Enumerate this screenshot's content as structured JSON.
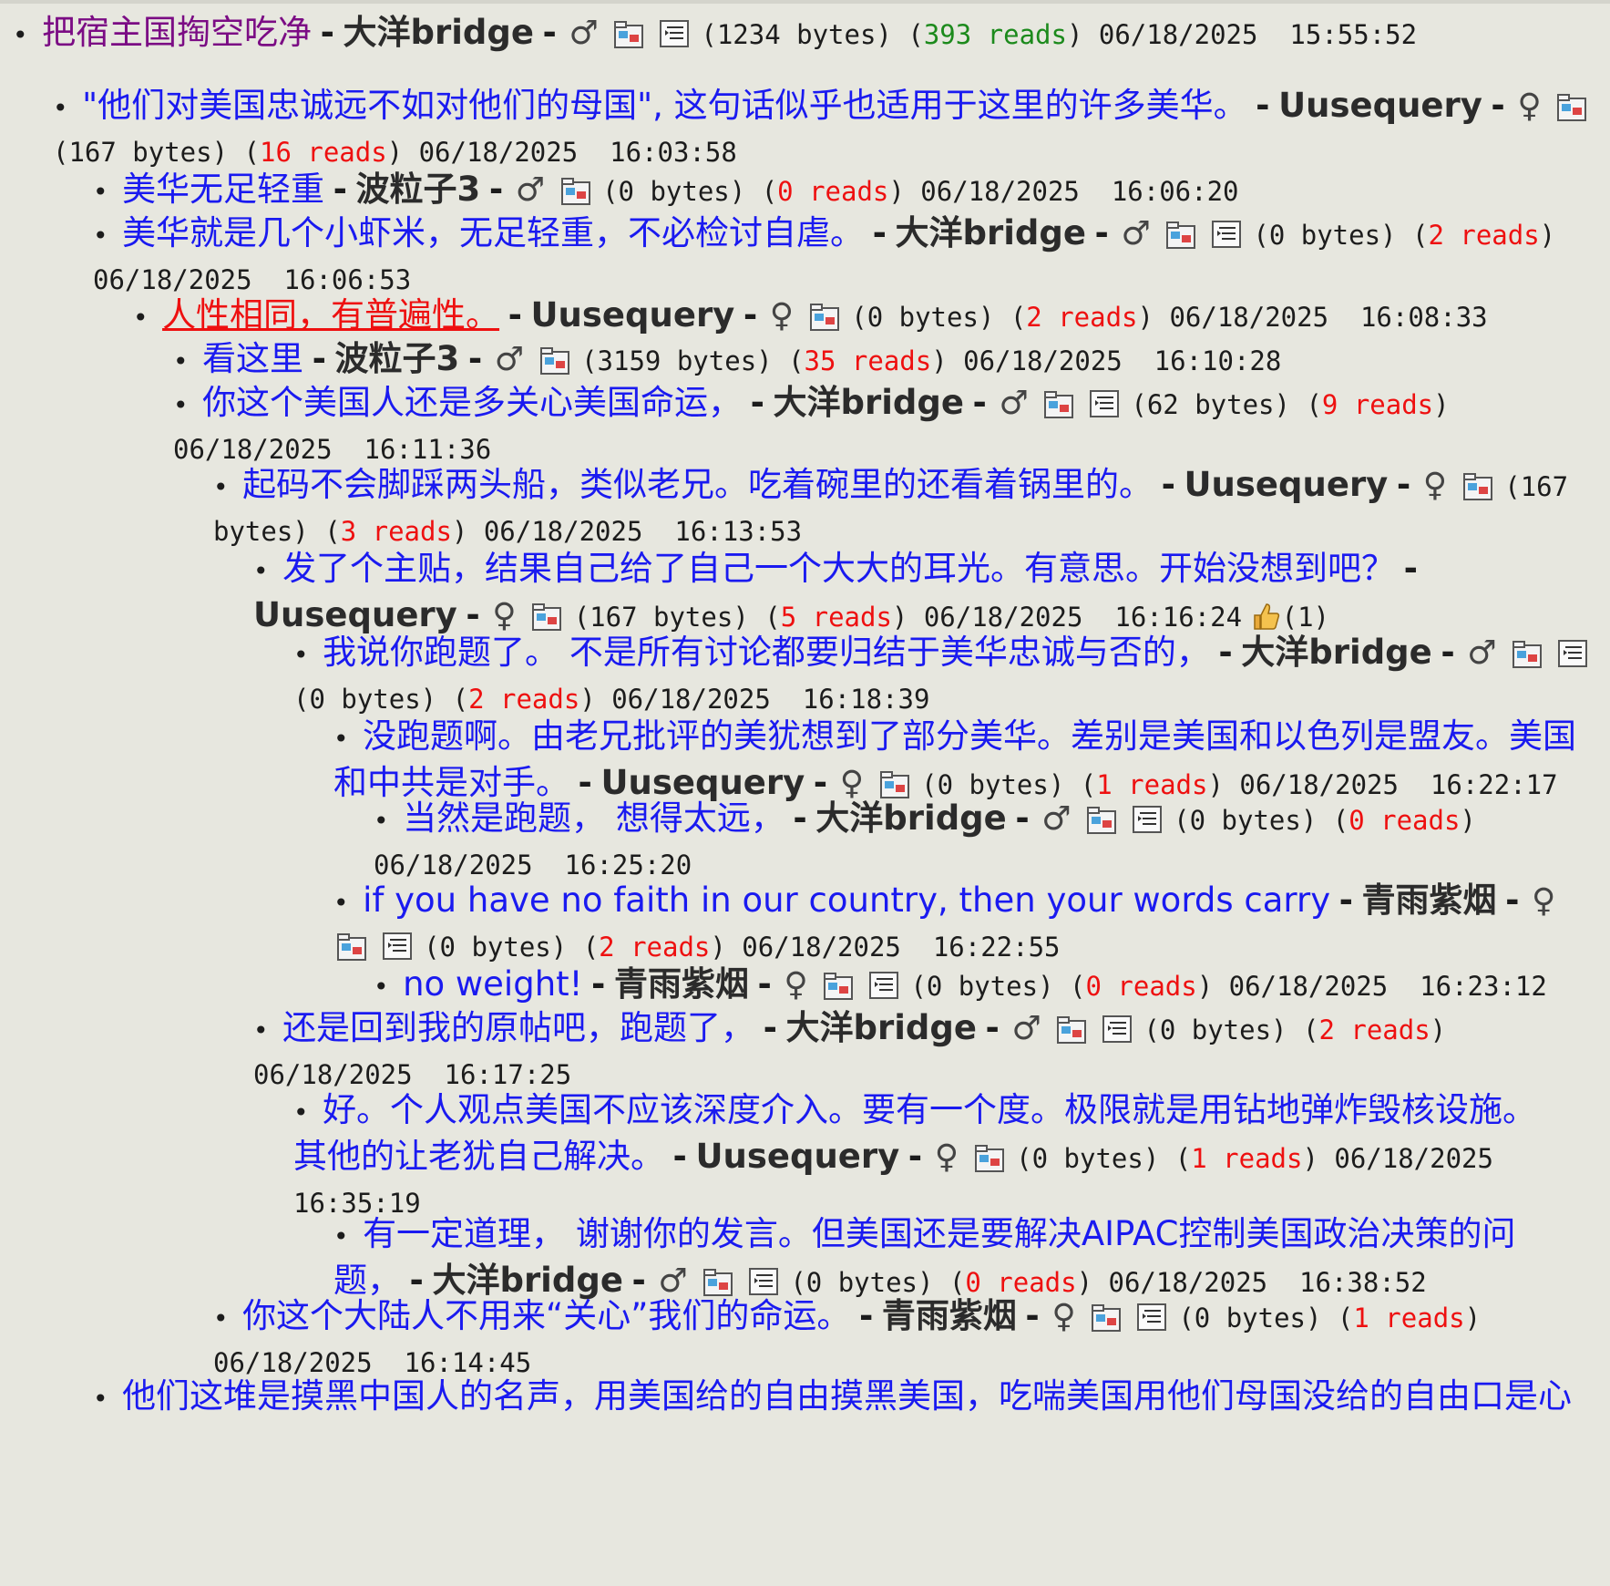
{
  "strings": {
    "dash": "-",
    "bullet": "•"
  },
  "posts": [
    {
      "title": "把宿主国掏空吃净",
      "author": "大洋bridge",
      "gender": "♂",
      "icons": [
        "folder",
        "doc"
      ],
      "size": "(1234 bytes)",
      "reads": "393 reads",
      "readsColor": "green",
      "date": "06/18/2025",
      "time": "15:55:52",
      "root": true
    },
    {
      "title": "\"他们对美国忠诚远不如对他们的母国\", 这句话似乎也适用于这里的许多美华。",
      "author": "Uusequery",
      "gender": "♀",
      "icons": [
        "folder"
      ],
      "size": "(167 bytes)",
      "reads": "16 reads",
      "readsColor": "red",
      "date": "06/18/2025",
      "time": "16:03:58"
    },
    {
      "title": "美华无足轻重",
      "author": "波粒子3",
      "gender": "♂",
      "icons": [
        "folder"
      ],
      "size": "(0 bytes)",
      "reads": "0 reads",
      "readsColor": "red",
      "date": "06/18/2025",
      "time": "16:06:20"
    },
    {
      "title": "美华就是几个小虾米，无足轻重，不必检讨自虐。",
      "author": "大洋bridge",
      "gender": "♂",
      "icons": [
        "folder",
        "doc"
      ],
      "size": "(0 bytes)",
      "reads": "2 reads",
      "readsColor": "red",
      "date": "06/18/2025",
      "time": "16:06:53"
    },
    {
      "title": "人性相同，有普遍性。",
      "author": "Uusequery",
      "gender": "♀",
      "icons": [
        "folder"
      ],
      "size": "(0 bytes)",
      "reads": "2 reads",
      "readsColor": "red",
      "date": "06/18/2025",
      "time": "16:08:33",
      "active": true
    },
    {
      "title": "看这里",
      "author": "波粒子3",
      "gender": "♂",
      "icons": [
        "folder"
      ],
      "size": "(3159 bytes)",
      "reads": "35 reads",
      "readsColor": "red",
      "date": "06/18/2025",
      "time": "16:10:28"
    },
    {
      "title": "你这个美国人还是多关心美国命运，",
      "author": "大洋bridge",
      "gender": "♂",
      "icons": [
        "folder",
        "doc"
      ],
      "size": "(62 bytes)",
      "reads": "9 reads",
      "readsColor": "red",
      "date": "06/18/2025",
      "time": "16:11:36"
    },
    {
      "title": "起码不会脚踩两头船，类似老兄。吃着碗里的还看着锅里的。",
      "author": "Uusequery",
      "gender": "♀",
      "icons": [
        "folder"
      ],
      "size": "(167 bytes)",
      "reads": "3 reads",
      "readsColor": "red",
      "date": "06/18/2025",
      "time": "16:13:53"
    },
    {
      "title": "发了个主贴，结果自己给了自己一个大大的耳光。有意思。开始没想到吧？",
      "author": "Uusequery",
      "gender": "♀",
      "icons": [
        "folder"
      ],
      "size": "(167 bytes)",
      "reads": "5 reads",
      "readsColor": "red",
      "date": "06/18/2025",
      "time": "16:16:24",
      "likes": "(1)"
    },
    {
      "title": "我说你跑题了。 不是所有讨论都要归结于美华忠诚与否的，",
      "author": "大洋bridge",
      "gender": "♂",
      "icons": [
        "folder",
        "doc"
      ],
      "size": "(0 bytes)",
      "reads": "2 reads",
      "readsColor": "red",
      "date": "06/18/2025",
      "time": "16:18:39"
    },
    {
      "title": "没跑题啊。由老兄批评的美犹想到了部分美华。差别是美国和以色列是盟友。美国和中共是对手。",
      "author": "Uusequery",
      "gender": "♀",
      "icons": [
        "folder"
      ],
      "size": "(0 bytes)",
      "reads": "1 reads",
      "readsColor": "red",
      "date": "06/18/2025",
      "time": "16:22:17"
    },
    {
      "title": "当然是跑题， 想得太远，",
      "author": "大洋bridge",
      "gender": "♂",
      "icons": [
        "folder",
        "doc"
      ],
      "size": "(0 bytes)",
      "reads": "0 reads",
      "readsColor": "red",
      "date": "06/18/2025",
      "time": "16:25:20"
    },
    {
      "title": "if you have no faith in our country, then your words carry",
      "author": "青雨紫烟",
      "gender": "♀",
      "icons": [
        "folder",
        "doc"
      ],
      "size": "(0 bytes)",
      "reads": "2 reads",
      "readsColor": "red",
      "date": "06/18/2025",
      "time": "16:22:55"
    },
    {
      "title": "no weight!",
      "author": "青雨紫烟",
      "gender": "♀",
      "icons": [
        "folder",
        "doc"
      ],
      "size": "(0 bytes)",
      "reads": "0 reads",
      "readsColor": "red",
      "date": "06/18/2025",
      "time": "16:23:12"
    },
    {
      "title": "还是回到我的原帖吧，跑题了，",
      "author": "大洋bridge",
      "gender": "♂",
      "icons": [
        "folder",
        "doc"
      ],
      "size": "(0 bytes)",
      "reads": "2 reads",
      "readsColor": "red",
      "date": "06/18/2025",
      "time": "16:17:25"
    },
    {
      "title": "好。个人观点美国不应该深度介入。要有一个度。极限就是用钻地弹炸毁核设施。其他的让老犹自己解决。",
      "author": "Uusequery",
      "gender": "♀",
      "icons": [
        "folder"
      ],
      "size": "(0 bytes)",
      "reads": "1 reads",
      "readsColor": "red",
      "date": "06/18/2025",
      "time": "16:35:19"
    },
    {
      "title": "有一定道理， 谢谢你的发言。但美国还是要解决AIPAC控制美国政治决策的问题，",
      "author": "大洋bridge",
      "gender": "♂",
      "icons": [
        "folder",
        "doc"
      ],
      "size": "(0 bytes)",
      "reads": "0 reads",
      "readsColor": "red",
      "date": "06/18/2025",
      "time": "16:38:52"
    },
    {
      "title": "你这个大陆人不用来“关心”我们的命运。",
      "author": "青雨紫烟",
      "gender": "♀",
      "icons": [
        "folder",
        "doc"
      ],
      "size": "(0 bytes)",
      "reads": "1 reads",
      "readsColor": "red",
      "date": "06/18/2025",
      "time": "16:14:45"
    },
    {
      "title": "他们这堆是摸黑中国人的名声，用美国给的自由摸黑美国，吃喘美国用他们母国没给的自由口是心",
      "partial": true
    }
  ]
}
